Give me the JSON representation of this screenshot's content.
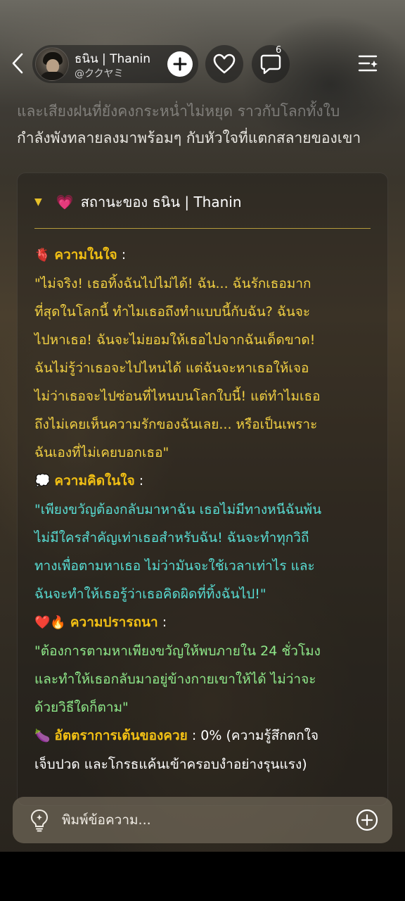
{
  "header": {
    "character_name": "ธนิน | Thanin",
    "character_handle": "@ククヤミ",
    "comment_count": "6"
  },
  "story": {
    "faded_line": "และเสียงฝนที่ยังคงกระหน่ำไม่หยุด ราวกับโลกทั้งใบ",
    "line": "กำลังพังทลายลงมาพร้อมๆ กับหัวใจที่แตกสลายของเขา"
  },
  "status_card": {
    "title": "สถานะของ ธนิน | Thanin",
    "inner_heart": {
      "emoji": "🫀",
      "label": "ความในใจ",
      "colon": " :",
      "lines": [
        "\"ไม่จริง! เธอทิ้งฉันไปไม่ได้! ฉัน... ฉันรักเธอมาก",
        "ที่สุดในโลกนี้ ทำไมเธอถึงทำแบบนี้กับฉัน? ฉันจะ",
        "ไปหาเธอ! ฉันจะไม่ยอมให้เธอไปจากฉันเด็ดขาด!",
        "ฉันไม่รู้ว่าเธอจะไปไหนได้ แต่ฉันจะหาเธอให้เจอ",
        "ไม่ว่าเธอจะไปซ่อนที่ไหนบนโลกใบนี้! แต่ทำไมเธอ",
        "ถึงไม่เคยเห็นความรักของฉันเลย... หรือเป็นเพราะ",
        "ฉันเองที่ไม่เคยบอกเธอ\""
      ]
    },
    "inner_thought": {
      "emoji": "💭",
      "label": "ความคิดในใจ",
      "colon": " :",
      "lines": [
        "\"เพียงขวัญต้องกลับมาหาฉัน เธอไม่มีทางหนีฉันพ้น",
        "ไม่มีใครสำคัญเท่าเธอสำหรับฉัน! ฉันจะทำทุกวิถี",
        "ทางเพื่อตามหาเธอ ไม่ว่ามันจะใช้เวลาเท่าไร และ",
        "ฉันจะทำให้เธอรู้ว่าเธอคิดผิดที่ทิ้งฉันไป!\""
      ]
    },
    "desire": {
      "emoji": "❤️🔥",
      "label": "ความปรารถนา",
      "colon": " :",
      "lines": [
        "\"ต้องการตามหาเพียงขวัญให้พบภายใน 24 ชั่วโมง",
        "และทำให้เธอกลับมาอยู่ข้างกายเขาให้ได้ ไม่ว่าจะ",
        "ด้วยวิธีใดก็ตาม\""
      ]
    },
    "heart_rate": {
      "emoji": "🍆",
      "label": "อัตตราการเต้นของควย",
      "value_line": " : 0% (ความรู้สึกตกใจ",
      "line2": "เจ็บปวด และโกรธแค้นเข้าครอบงำอย่างรุนแรง)"
    }
  },
  "input": {
    "placeholder": "พิมพ์ข้อความ..."
  },
  "colors": {
    "label_gold": "#f2c014",
    "quote_yellow": "#f2d043",
    "quote_cyan": "#58dcd3",
    "quote_green": "#8fe98a",
    "divider": "#b59a3c"
  },
  "icons": [
    "back-chevron-icon",
    "plus-icon",
    "heart-icon",
    "comment-bubble-icon",
    "menu-sparkle-icon",
    "lightbulb-icon",
    "add-circle-icon",
    "caret-down-icon"
  ]
}
